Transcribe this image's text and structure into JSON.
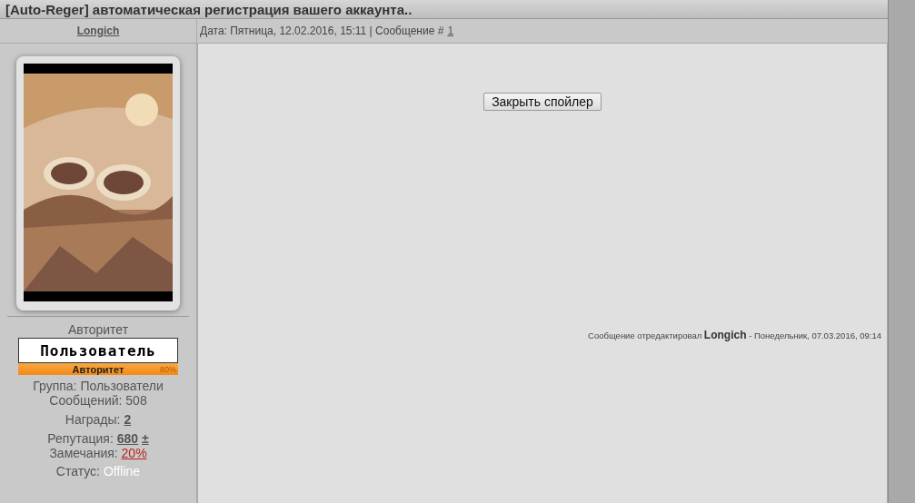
{
  "topic_title": "[Auto-Reger] автоматическая регистрация вашего аккаунта..",
  "post": {
    "author": "Longich",
    "date": "Дата: Пятница, 12.02.2016, 15:11 | Сообщение # ",
    "number": "1",
    "rank_title": "Авторитет",
    "rank_badge": {
      "name": "Пользователь",
      "label": "Авторитет",
      "percent": "80%"
    },
    "group": "Группа: Пользователи",
    "messages": "Сообщений: 508",
    "awards_label": "Награды: ",
    "awards": "2",
    "reputation_label": "Репутация: ",
    "reputation": "680",
    "reputation_sign": "±",
    "warnings_label": "Замечания: ",
    "warnings": "20%",
    "status_label": "Статус: ",
    "status": "Offline",
    "spoiler_button": "Закрыть спойлер",
    "edit_note": {
      "prefix": "Сообщение отредактировал ",
      "editor": "Longich",
      "suffix": " - Понедельник, 07.03.2016, 09:14"
    }
  }
}
